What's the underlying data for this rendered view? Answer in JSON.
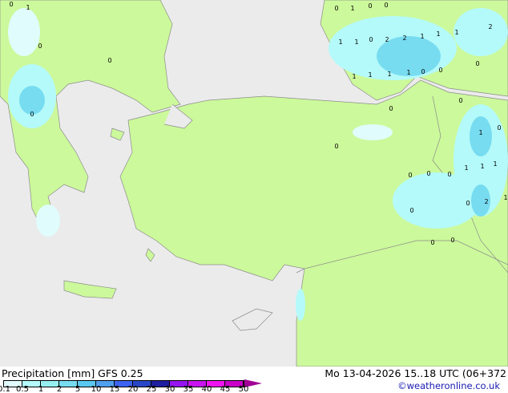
{
  "title": "Precipitation [mm]  GFS 0.25",
  "valid_time": "Mo 13-04-2026 15..18 UTC (06+372",
  "credit": "©weatheronline.co.uk",
  "colors": {
    "sea": "#ebebeb",
    "land": "#ccf99b",
    "border": "#8c8c8c"
  },
  "legend": {
    "ticks": [
      "0.1",
      "0.5",
      "1",
      "2",
      "5",
      "10",
      "15",
      "20",
      "25",
      "30",
      "35",
      "40",
      "45",
      "50"
    ],
    "colors": [
      "#e0fcfc",
      "#b4fafa",
      "#96f0f0",
      "#78dcf0",
      "#5ac8f0",
      "#50a0f0",
      "#3c64f0",
      "#2846c8",
      "#1e1ea0",
      "#9614f0",
      "#c814f0",
      "#f014f0",
      "#c800c8"
    ],
    "overflow_color": "#a00096"
  },
  "map_labels": [
    "0",
    "1",
    "0",
    "0",
    "0",
    "0",
    "1",
    "0",
    "0",
    "1",
    "1",
    "2",
    "2",
    "0",
    "1",
    "1",
    "2",
    "1",
    "1",
    "1",
    "1",
    "1",
    "0",
    "0",
    "0",
    "0",
    "1",
    "0",
    "0",
    "1",
    "1",
    "1",
    "0",
    "2",
    "1",
    "0",
    "0",
    "0",
    "0",
    "0",
    "0",
    "0"
  ]
}
